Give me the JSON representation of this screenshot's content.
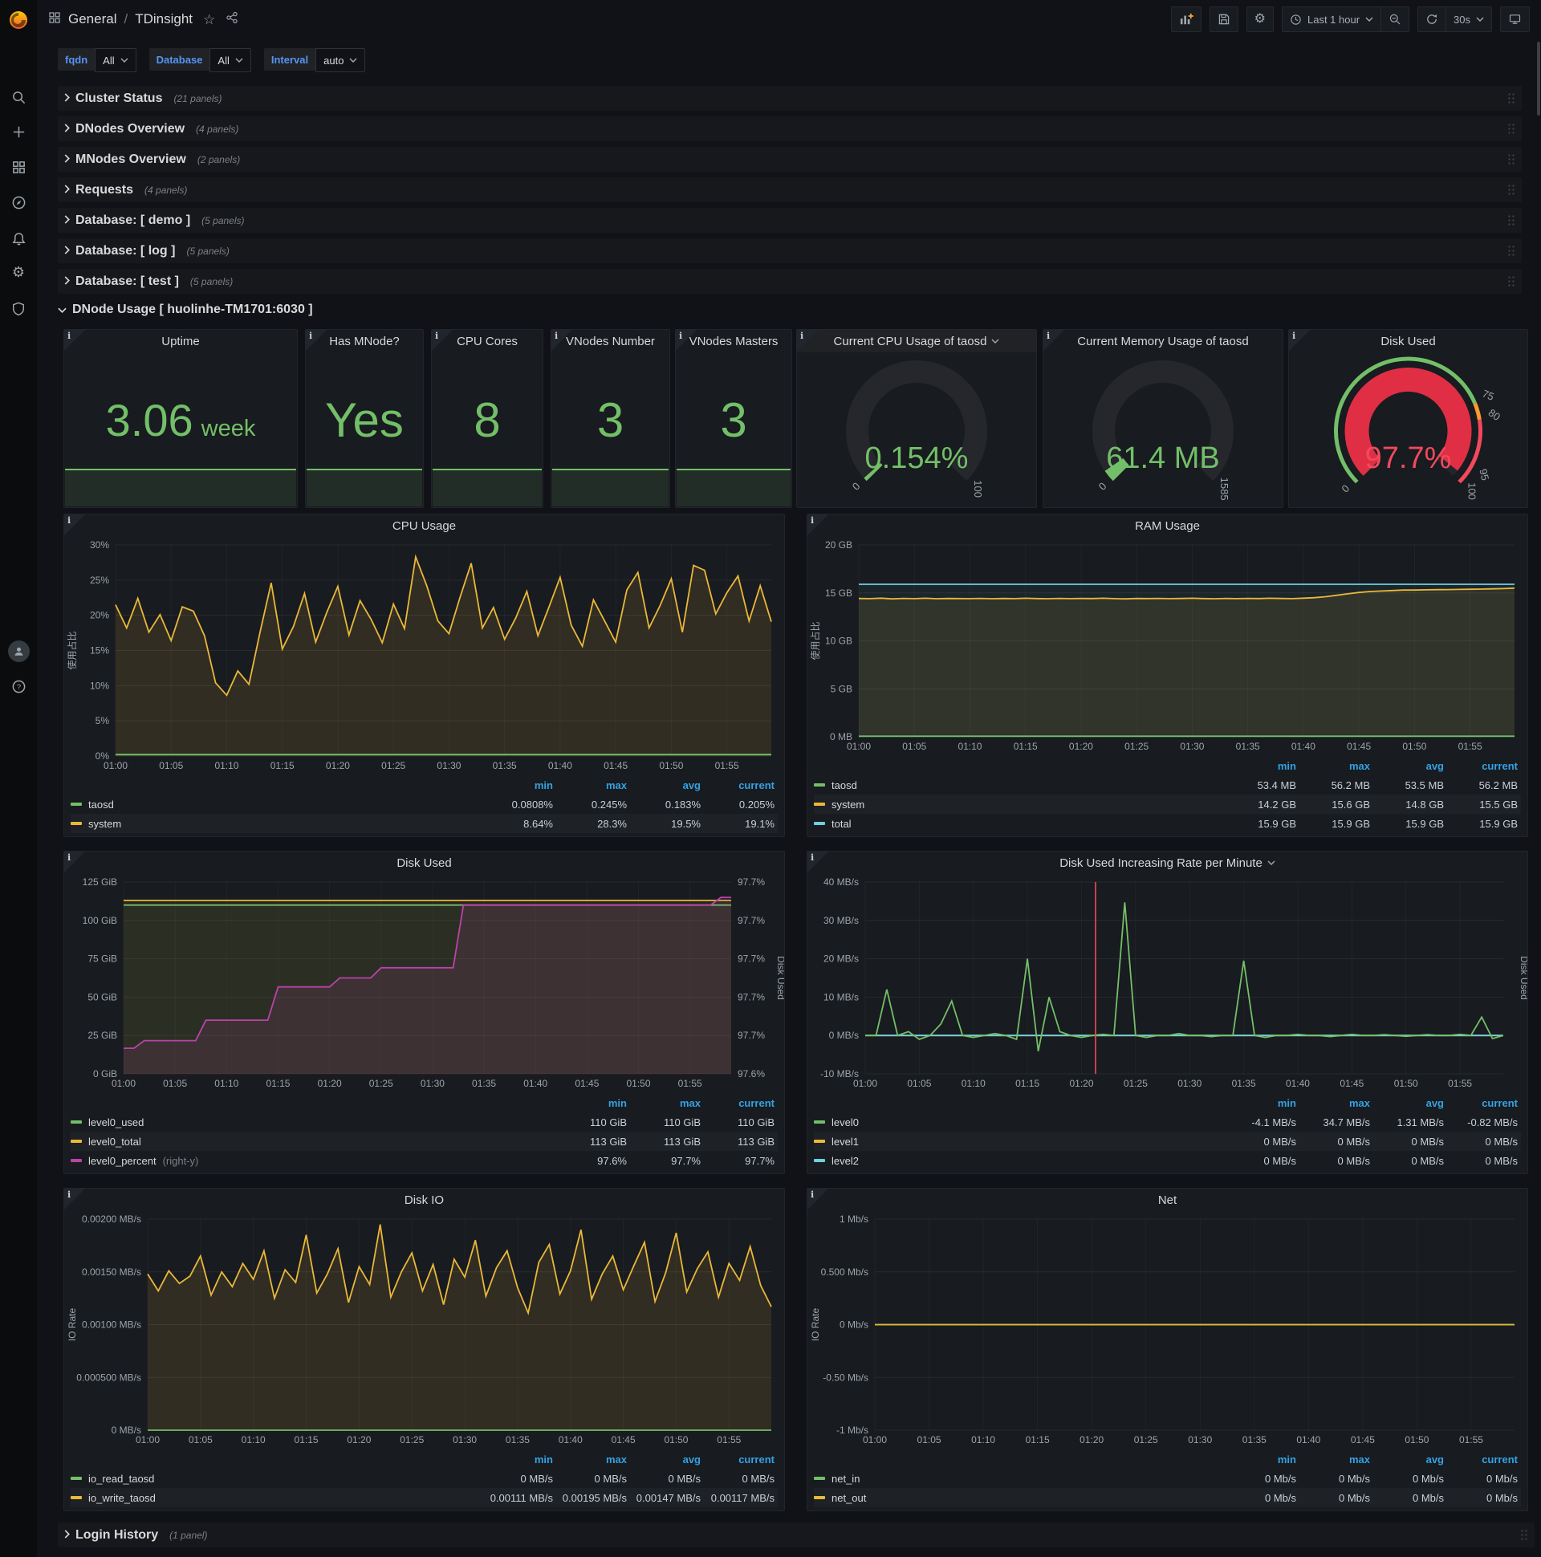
{
  "nav": {
    "breadcrumb": {
      "section": "General",
      "separator": "/",
      "title": "TDinsight"
    },
    "time_range": "Last 1 hour",
    "refresh_interval": "30s"
  },
  "icons": {
    "gear": "⚙",
    "star": "☆",
    "help": "?"
  },
  "variables": [
    {
      "label": "fqdn",
      "value": "All"
    },
    {
      "label": "Database",
      "value": "All"
    },
    {
      "label": "Interval",
      "value": "auto"
    }
  ],
  "rows": [
    {
      "title": "Cluster Status",
      "count": "(21 panels)"
    },
    {
      "title": "DNodes Overview",
      "count": "(4 panels)"
    },
    {
      "title": "MNodes Overview",
      "count": "(2 panels)"
    },
    {
      "title": "Requests",
      "count": "(4 panels)"
    },
    {
      "title": "Database: [ demo ]",
      "count": "(5 panels)"
    },
    {
      "title": "Database: [ log ]",
      "count": "(5 panels)"
    },
    {
      "title": "Database: [ test ]",
      "count": "(5 panels)"
    }
  ],
  "expanded_row": {
    "title": "DNode Usage [ huolinhe-TM1701:6030 ]"
  },
  "bottom_row": {
    "title": "Login History",
    "count": "(1 panel)"
  },
  "stats": [
    {
      "title": "Uptime",
      "value": "3.06",
      "unit": "week"
    },
    {
      "title": "Has MNode?",
      "value": "Yes",
      "unit": ""
    },
    {
      "title": "CPU Cores",
      "value": "8",
      "unit": ""
    },
    {
      "title": "VNodes Number",
      "value": "3",
      "unit": ""
    },
    {
      "title": "VNodes Masters",
      "value": "3",
      "unit": ""
    }
  ],
  "gauges": [
    {
      "id": "gauge-cpu",
      "title": "Current CPU Usage of taosd",
      "dropdown": true,
      "value": "0.154%",
      "fraction": 0.0015,
      "value_color": "#73bf69",
      "bar_color": "#73bf69",
      "labels": [
        {
          "text": "0",
          "f": 0
        },
        {
          "text": "100",
          "f": 1
        }
      ]
    },
    {
      "id": "gauge-mem",
      "title": "Current Memory Usage of taosd",
      "dropdown": false,
      "value": "61.4 MB",
      "fraction": 0.0387,
      "value_color": "#73bf69",
      "bar_color": "#73bf69",
      "labels": [
        {
          "text": "0",
          "f": 0
        },
        {
          "text": "1585",
          "f": 1
        }
      ]
    },
    {
      "id": "gauge-disk",
      "title": "Disk Used",
      "dropdown": false,
      "value": "97.7%",
      "fraction": 0.977,
      "value_color": "#f2495c",
      "bar_color": "#e02f44",
      "thresholds": [
        {
          "to": 0.75,
          "color": "#73bf69"
        },
        {
          "to": 0.8,
          "color": "#ff9830"
        },
        {
          "to": 1,
          "color": "#f2495c"
        }
      ],
      "labels": [
        {
          "text": "0",
          "f": 0
        },
        {
          "text": "75",
          "f": 0.75
        },
        {
          "text": "80",
          "f": 0.8
        },
        {
          "text": "95",
          "f": 0.95
        },
        {
          "text": "100",
          "f": 1
        }
      ]
    }
  ],
  "chart_data": [
    {
      "id": "cpu",
      "type": "line",
      "title": "CPU Usage",
      "dropdown": false,
      "ylabel": "使用占比",
      "ylim": [
        0,
        30
      ],
      "yticks": [
        "0%",
        "5%",
        "10%",
        "15%",
        "20%",
        "25%",
        "30%"
      ],
      "xticks": [
        "01:00",
        "01:05",
        "01:10",
        "01:15",
        "01:20",
        "01:25",
        "01:30",
        "01:35",
        "01:40",
        "01:45",
        "01:50",
        "01:55"
      ],
      "pad": [
        64,
        16
      ],
      "series": [
        {
          "name": "system",
          "color": "#eab839",
          "fill": 0.12,
          "values": [
            21.5,
            18.2,
            22.4,
            17.6,
            20.1,
            16.4,
            21.2,
            20.6,
            17.1,
            10.4,
            8.64,
            12.1,
            10.2,
            17.6,
            24.6,
            15.2,
            18.4,
            23.1,
            16.2,
            20.4,
            24.1,
            17.2,
            22.1,
            19.4,
            16.1,
            21.6,
            18.1,
            28.3,
            24.2,
            19.2,
            17.4,
            22.6,
            27.4,
            18.2,
            21.1,
            16.6,
            19.6,
            23.4,
            17.1,
            21.2,
            25.4,
            18.6,
            15.6,
            22.2,
            19.2,
            16.2,
            23.6,
            26.1,
            18.2,
            21.4,
            25.2,
            17.6,
            27.1,
            26.4,
            20.2,
            23.2,
            25.6,
            19.2,
            24.2,
            19.1
          ]
        },
        {
          "name": "taosd",
          "color": "#73bf69",
          "fill": 0.06,
          "const": 0.2
        }
      ],
      "legend": {
        "headers": [
          "min",
          "max",
          "avg",
          "current"
        ],
        "rows": [
          {
            "name": "taosd",
            "color": "#73bf69",
            "values": [
              "0.0808%",
              "0.245%",
              "0.183%",
              "0.205%"
            ]
          },
          {
            "name": "system",
            "color": "#eab839",
            "values": [
              "8.64%",
              "28.3%",
              "19.5%",
              "19.1%"
            ]
          }
        ]
      }
    },
    {
      "id": "ram",
      "type": "line",
      "title": "RAM Usage",
      "dropdown": false,
      "ylabel": "使用占比",
      "ylim": [
        0,
        20
      ],
      "yticks": [
        "0 MB",
        "5 GB",
        "10 GB",
        "15 GB",
        "20 GB"
      ],
      "xticks": [
        "01:00",
        "01:05",
        "01:10",
        "01:15",
        "01:20",
        "01:25",
        "01:30",
        "01:35",
        "01:40",
        "01:45",
        "01:50",
        "01:55"
      ],
      "pad": [
        64,
        16
      ],
      "series": [
        {
          "name": "total",
          "color": "#6ed0e0",
          "fill": 0.06,
          "const": 15.9
        },
        {
          "name": "system",
          "color": "#eab839",
          "fill": 0.1,
          "values": [
            14.42,
            14.4,
            14.45,
            14.38,
            14.43,
            14.4,
            14.44,
            14.39,
            14.42,
            14.41,
            14.4,
            14.43,
            14.39,
            14.42,
            14.4,
            14.44,
            14.41,
            14.39,
            14.43,
            14.4,
            14.42,
            14.41,
            14.44,
            14.4,
            14.38,
            14.42,
            14.41,
            14.43,
            14.4,
            14.42,
            14.44,
            14.41,
            14.39,
            14.42,
            14.4,
            14.43,
            14.41,
            14.44,
            14.42,
            14.4,
            14.45,
            14.5,
            14.6,
            14.75,
            14.9,
            15.05,
            15.15,
            15.2,
            15.25,
            15.3,
            15.3,
            15.32,
            15.34,
            15.35,
            15.36,
            15.38,
            15.4,
            15.42,
            15.45,
            15.5
          ]
        },
        {
          "name": "taosd",
          "color": "#73bf69",
          "fill": 0.05,
          "const": 0.055
        }
      ],
      "legend": {
        "headers": [
          "min",
          "max",
          "avg",
          "current"
        ],
        "rows": [
          {
            "name": "taosd",
            "color": "#73bf69",
            "values": [
              "53.4 MB",
              "56.2 MB",
              "53.5 MB",
              "56.2 MB"
            ]
          },
          {
            "name": "system",
            "color": "#eab839",
            "values": [
              "14.2 GB",
              "15.6 GB",
              "14.8 GB",
              "15.5 GB"
            ]
          },
          {
            "name": "total",
            "color": "#6ed0e0",
            "values": [
              "15.9 GB",
              "15.9 GB",
              "15.9 GB",
              "15.9 GB"
            ]
          }
        ]
      }
    },
    {
      "id": "disk",
      "type": "line",
      "title": "Disk Used",
      "dropdown": false,
      "right_label": "Disk Used",
      "ylim": [
        0,
        125
      ],
      "yticks": [
        "0 GiB",
        "25 GiB",
        "50 GiB",
        "75 GiB",
        "100 GiB",
        "125 GiB"
      ],
      "rlim": [
        97.575,
        97.725
      ],
      "rticks": [
        "97.6%",
        "97.7%",
        "97.7%",
        "97.7%",
        "97.7%",
        "97.7%"
      ],
      "xticks": [
        "01:00",
        "01:05",
        "01:10",
        "01:15",
        "01:20",
        "01:25",
        "01:30",
        "01:35",
        "01:40",
        "01:45",
        "01:50",
        "01:55"
      ],
      "pad": [
        74,
        66
      ],
      "series": [
        {
          "name": "level0_total",
          "color": "#eab839",
          "fill": 0.07,
          "const": 113
        },
        {
          "name": "level0_used",
          "color": "#73bf69",
          "fill": 0.05,
          "const": 110
        },
        {
          "name": "level0_percent",
          "color": "#ba43a9",
          "fill": 0.13,
          "axis": "right",
          "values": [
            97.595,
            97.595,
            97.601,
            97.601,
            97.601,
            97.601,
            97.601,
            97.601,
            97.617,
            97.617,
            97.617,
            97.617,
            97.617,
            97.617,
            97.617,
            97.643,
            97.643,
            97.643,
            97.643,
            97.643,
            97.643,
            97.65,
            97.65,
            97.65,
            97.65,
            97.658,
            97.658,
            97.658,
            97.658,
            97.658,
            97.658,
            97.658,
            97.658,
            97.707,
            97.707,
            97.707,
            97.707,
            97.707,
            97.707,
            97.707,
            97.707,
            97.707,
            97.707,
            97.707,
            97.707,
            97.707,
            97.707,
            97.707,
            97.707,
            97.707,
            97.707,
            97.707,
            97.707,
            97.707,
            97.707,
            97.707,
            97.707,
            97.707,
            97.713,
            97.713
          ]
        }
      ],
      "legend": {
        "headers": [
          "min",
          "max",
          "current"
        ],
        "rows": [
          {
            "name": "level0_used",
            "color": "#73bf69",
            "values": [
              "110 GiB",
              "110 GiB",
              "110 GiB"
            ]
          },
          {
            "name": "level0_total",
            "color": "#eab839",
            "values": [
              "113 GiB",
              "113 GiB",
              "113 GiB"
            ]
          },
          {
            "name": "level0_percent",
            "suffix": "(right-y)",
            "color": "#ba43a9",
            "values": [
              "97.6%",
              "97.7%",
              "97.7%"
            ]
          }
        ]
      }
    },
    {
      "id": "rate",
      "type": "line",
      "title": "Disk Used Increasing Rate per Minute",
      "dropdown": true,
      "right_label": "Disk Used",
      "ylim": [
        -10,
        40
      ],
      "yticks": [
        "-10 MB/s",
        "0 MB/s",
        "10 MB/s",
        "20 MB/s",
        "30 MB/s",
        "40 MB/s"
      ],
      "xticks": [
        "01:00",
        "01:05",
        "01:10",
        "01:15",
        "01:20",
        "01:25",
        "01:30",
        "01:35",
        "01:40",
        "01:45",
        "01:50",
        "01:55"
      ],
      "pad": [
        72,
        30
      ],
      "vline": {
        "f": 0.361,
        "color": "#f2495c"
      },
      "series": [
        {
          "name": "level1",
          "color": "#eab839",
          "const": 0
        },
        {
          "name": "level2",
          "color": "#6ed0e0",
          "const": 0
        },
        {
          "name": "level0",
          "color": "#73bf69",
          "values": [
            0,
            0,
            12,
            0,
            1,
            -1,
            0,
            3,
            9,
            0,
            -0.5,
            0,
            0.5,
            0,
            -1,
            20,
            -4.1,
            10,
            1,
            0,
            -0.5,
            0,
            0.3,
            0,
            34.7,
            0,
            -0.5,
            0,
            0,
            0.5,
            0,
            0,
            -0.3,
            0,
            0,
            19.5,
            0,
            -0.5,
            0,
            0,
            0.3,
            0,
            0,
            -0.3,
            0,
            0.3,
            0,
            0,
            0.2,
            0,
            -0.2,
            0,
            0.2,
            0,
            0,
            0.3,
            0,
            4.8,
            -0.82,
            0
          ]
        }
      ],
      "legend": {
        "headers": [
          "min",
          "max",
          "avg",
          "current"
        ],
        "rows": [
          {
            "name": "level0",
            "color": "#73bf69",
            "values": [
              "-4.1 MB/s",
              "34.7 MB/s",
              "1.31 MB/s",
              "-0.82 MB/s"
            ]
          },
          {
            "name": "level1",
            "color": "#eab839",
            "values": [
              "0 MB/s",
              "0 MB/s",
              "0 MB/s",
              "0 MB/s"
            ]
          },
          {
            "name": "level2",
            "color": "#6ed0e0",
            "values": [
              "0 MB/s",
              "0 MB/s",
              "0 MB/s",
              "0 MB/s"
            ]
          }
        ]
      }
    },
    {
      "id": "io",
      "type": "line",
      "title": "Disk IO",
      "dropdown": false,
      "ylabel": "IO Rate",
      "ylim": [
        0,
        0.002
      ],
      "yticks": [
        "0 MB/s",
        "0.000500 MB/s",
        "0.00100 MB/s",
        "0.00150 MB/s",
        "0.00200 MB/s"
      ],
      "xticks": [
        "01:00",
        "01:05",
        "01:10",
        "01:15",
        "01:20",
        "01:25",
        "01:30",
        "01:35",
        "01:40",
        "01:45",
        "01:50",
        "01:55"
      ],
      "pad": [
        104,
        16
      ],
      "series": [
        {
          "name": "io_write_taosd",
          "color": "#eab839",
          "fill": 0.12,
          "values": [
            0.00148,
            0.00132,
            0.00151,
            0.00139,
            0.00146,
            0.00165,
            0.00128,
            0.0015,
            0.00136,
            0.00158,
            0.00143,
            0.0017,
            0.00125,
            0.00152,
            0.0014,
            0.00185,
            0.0013,
            0.00148,
            0.00172,
            0.00121,
            0.00155,
            0.00138,
            0.00195,
            0.00126,
            0.0015,
            0.00168,
            0.00132,
            0.00157,
            0.00119,
            0.00162,
            0.00145,
            0.0018,
            0.00127,
            0.00154,
            0.0017,
            0.00135,
            0.00111,
            0.00159,
            0.00176,
            0.00129,
            0.00151,
            0.0019,
            0.00124,
            0.00148,
            0.00165,
            0.00133,
            0.00156,
            0.00178,
            0.00122,
            0.00149,
            0.00187,
            0.00131,
            0.00153,
            0.00169,
            0.00126,
            0.00158,
            0.00142,
            0.00174,
            0.00137,
            0.00117
          ]
        },
        {
          "name": "io_read_taosd",
          "color": "#73bf69",
          "const": 0
        }
      ],
      "legend": {
        "headers": [
          "min",
          "max",
          "avg",
          "current"
        ],
        "rows": [
          {
            "name": "io_read_taosd",
            "color": "#73bf69",
            "values": [
              "0 MB/s",
              "0 MB/s",
              "0 MB/s",
              "0 MB/s"
            ]
          },
          {
            "name": "io_write_taosd",
            "color": "#eab839",
            "values": [
              "0.00111 MB/s",
              "0.00195 MB/s",
              "0.00147 MB/s",
              "0.00117 MB/s"
            ]
          }
        ]
      }
    },
    {
      "id": "net",
      "type": "line",
      "title": "Net",
      "dropdown": false,
      "ylabel": "IO Rate",
      "ylim": [
        -1,
        1
      ],
      "yticks": [
        "-1 Mb/s",
        "-0.50 Mb/s",
        "0 Mb/s",
        "0.500 Mb/s",
        "1 Mb/s"
      ],
      "xticks": [
        "01:00",
        "01:05",
        "01:10",
        "01:15",
        "01:20",
        "01:25",
        "01:30",
        "01:35",
        "01:40",
        "01:45",
        "01:50",
        "01:55"
      ],
      "pad": [
        84,
        16
      ],
      "series": [
        {
          "name": "net_in",
          "color": "#73bf69",
          "const": 0
        },
        {
          "name": "net_out",
          "color": "#eab839",
          "const": 0
        }
      ],
      "legend": {
        "headers": [
          "min",
          "max",
          "avg",
          "current"
        ],
        "rows": [
          {
            "name": "net_in",
            "color": "#73bf69",
            "values": [
              "0 Mb/s",
              "0 Mb/s",
              "0 Mb/s",
              "0 Mb/s"
            ]
          },
          {
            "name": "net_out",
            "color": "#eab839",
            "values": [
              "0 Mb/s",
              "0 Mb/s",
              "0 Mb/s",
              "0 Mb/s"
            ]
          }
        ]
      }
    }
  ],
  "colors": {
    "green": "#73bf69",
    "yellow": "#eab839",
    "blue": "#6ed0e0",
    "purple": "#ba43a9",
    "red": "#e02f44",
    "red_text": "#f2495c",
    "link_blue": "#5794f2",
    "header_blue": "#33a2e5",
    "panel_bg": "#181b1f",
    "page_bg": "#111217"
  }
}
